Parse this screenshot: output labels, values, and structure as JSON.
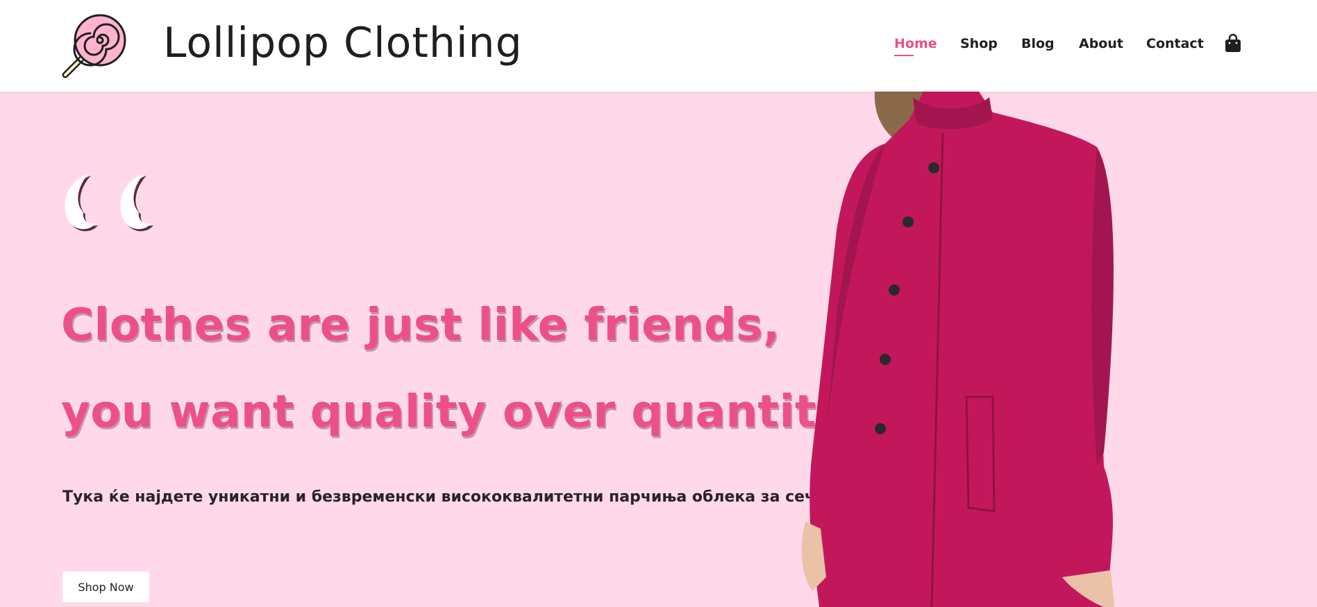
{
  "brand": {
    "name": "Lollipop Clothing",
    "logo_icon": "lollipop-icon"
  },
  "nav": {
    "items": [
      {
        "label": "Home",
        "active": true
      },
      {
        "label": "Shop",
        "active": false
      },
      {
        "label": "Blog",
        "active": false
      },
      {
        "label": "About",
        "active": false
      },
      {
        "label": "Contact",
        "active": false
      }
    ],
    "cart_icon": "shopping-bag-icon"
  },
  "hero": {
    "quote_icon": "quote-icon",
    "headline_line1": "Clothes are just like friends,",
    "headline_line2": "you want quality over quantity",
    "subtitle": "Тука ќе најдете уникатни и безвременски висококвалитетни парчиња облека за сечиј вкус.",
    "cta_label": "Shop Now",
    "image": "woman-in-magenta-coat"
  },
  "colors": {
    "accent": "#ec4f8a",
    "hero_bg": "#ffd9ea",
    "coat": "#c2185b",
    "text": "#1f1f1f"
  }
}
